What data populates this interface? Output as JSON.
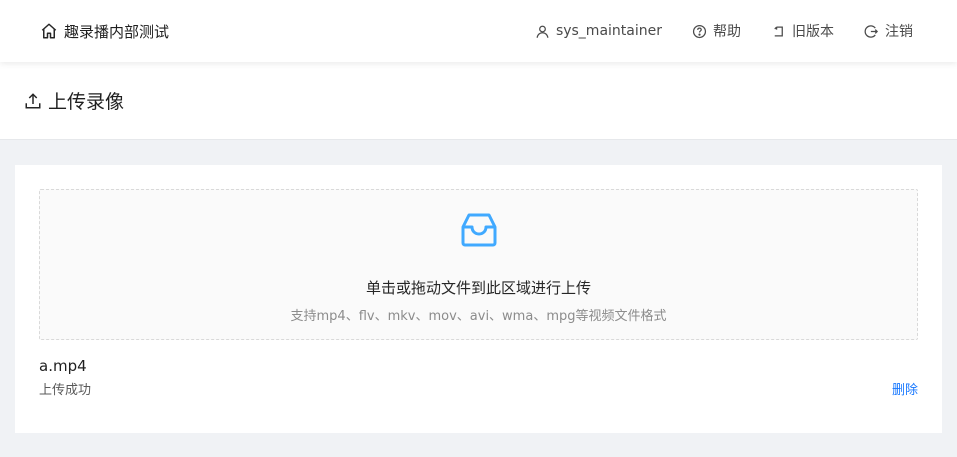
{
  "topbar": {
    "brand": {
      "icon": "home-icon",
      "title": "趣录播内部测试"
    },
    "nav": [
      {
        "icon": "user-icon",
        "label": "sys_maintainer"
      },
      {
        "icon": "help-circle-icon",
        "label": "帮助"
      },
      {
        "icon": "rollback-icon",
        "label": "旧版本"
      },
      {
        "icon": "logout-icon",
        "label": "注销"
      }
    ]
  },
  "page_header": {
    "icon": "upload-icon",
    "title": "上传录像"
  },
  "upload": {
    "icon": "inbox-icon",
    "title": "单击或拖动文件到此区域进行上传",
    "hint": "支持mp4、flv、mkv、mov、avi、wma、mpg等视频文件格式",
    "accent_color": "#40a9ff"
  },
  "files": [
    {
      "name": "a.mp4",
      "status": "上传成功",
      "delete_label": "删除"
    }
  ],
  "colors": {
    "link": "#1677ff",
    "background": "#f0f2f5"
  }
}
